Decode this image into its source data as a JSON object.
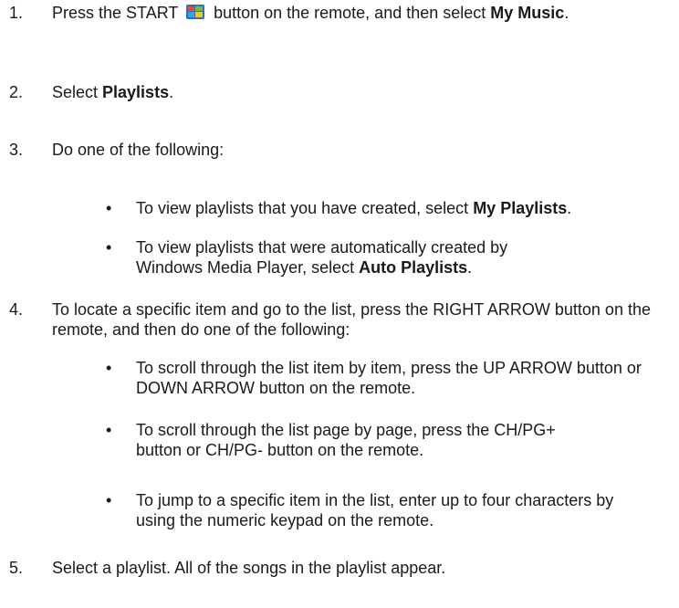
{
  "steps": [
    {
      "num": "1.",
      "parts": [
        {
          "text": "Press the START ",
          "bold": false
        },
        {
          "icon": "windows-start-icon"
        },
        {
          "text": " button on the remote, and then select ",
          "bold": false
        },
        {
          "text": "My Music",
          "bold": true
        },
        {
          "text": ".",
          "bold": false
        }
      ]
    },
    {
      "num": "2.",
      "parts": [
        {
          "text": "Select ",
          "bold": false
        },
        {
          "text": "Playlists",
          "bold": true
        },
        {
          "text": ".",
          "bold": false
        }
      ]
    },
    {
      "num": "3.",
      "parts": [
        {
          "text": "Do one of the following:",
          "bold": false
        }
      ],
      "bullets": [
        {
          "parts": [
            {
              "text": "To view playlists that you have created, select ",
              "bold": false
            },
            {
              "text": "My Playlists",
              "bold": true
            },
            {
              "text": ".",
              "bold": false
            }
          ]
        },
        {
          "parts": [
            {
              "text": "To view playlists that were automatically created by Windows Media Player, select ",
              "bold": false
            },
            {
              "text": "Auto Playlists",
              "bold": true
            },
            {
              "text": ".",
              "bold": false
            }
          ]
        }
      ]
    },
    {
      "num": "4.",
      "parts": [
        {
          "text": "To locate a specific item and go to the list, press the RIGHT ARROW button on the remote, and then do one of the following:",
          "bold": false
        }
      ],
      "bullets": [
        {
          "parts": [
            {
              "text": "To scroll through the list item by item, press the UP ARROW button or DOWN ARROW button on the remote.",
              "bold": false
            }
          ]
        },
        {
          "parts": [
            {
              "text": "To scroll through the list page by page, press the CH/PG+ button or CH/PG- button on the remote.",
              "bold": false
            }
          ]
        },
        {
          "parts": [
            {
              "text": "To jump to a specific item in the list, enter up to four characters by using the numeric keypad on the remote.",
              "bold": false
            }
          ]
        }
      ]
    },
    {
      "num": "5.",
      "parts": [
        {
          "text": "Select a playlist. All of the songs in the playlist appear.",
          "bold": false
        }
      ]
    }
  ],
  "bullet_glyph": "•"
}
